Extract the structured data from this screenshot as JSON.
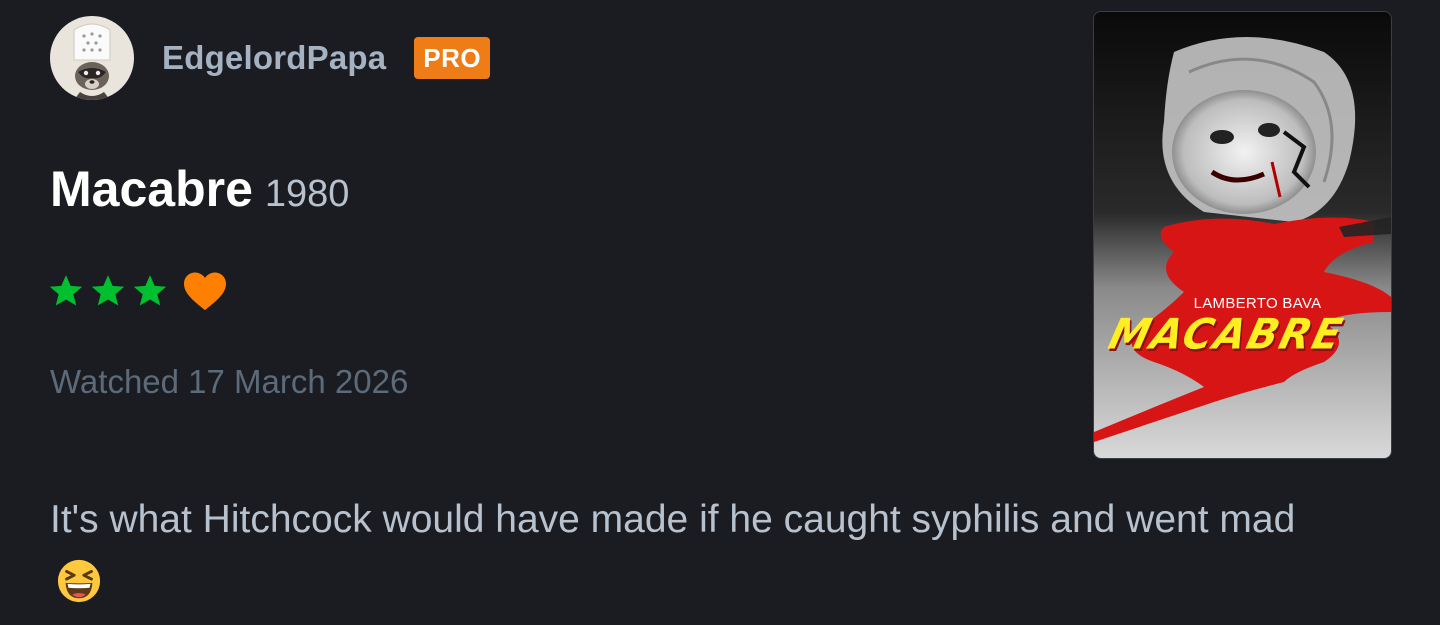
{
  "user": {
    "username": "EdgelordPapa",
    "badge": "PRO",
    "avatar_icon": "raccoon-chef-avatar"
  },
  "film": {
    "title": "Macabre",
    "year": "1980",
    "poster": {
      "director_credit": "LAMBERTO BAVA",
      "title_text": "MACABRE"
    }
  },
  "rating": {
    "stars": 3,
    "max_stars": 5,
    "liked": true,
    "star_color": "#00c030",
    "heart_color": "#ff8000"
  },
  "watched_label": "Watched 17 March 2026",
  "review": {
    "text": "It's what Hitchcock would have made if he caught syphilis and went mad",
    "emoji": "grinning-squinting-face"
  },
  "colors": {
    "background": "#1a1c21",
    "username": "#a4b2c2",
    "badge_bg": "#ef7d17",
    "muted_text": "#5d6a79",
    "body_text": "#b8c2cf"
  }
}
